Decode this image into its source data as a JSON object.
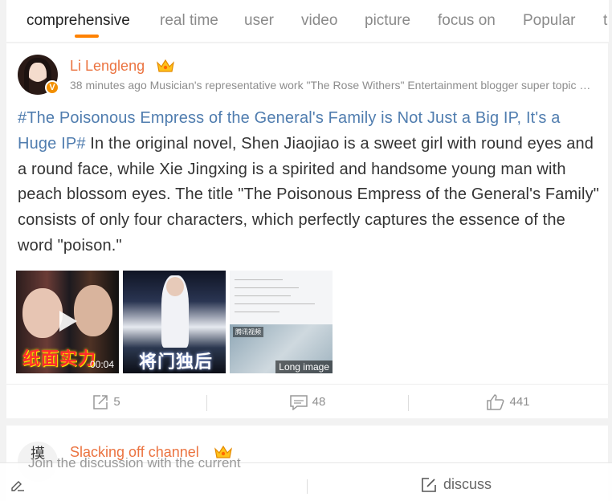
{
  "tabs": [
    "comprehensive",
    "real time",
    "user",
    "video",
    "picture",
    "focus on",
    "Popular",
    "t"
  ],
  "active_tab": "comprehensive",
  "colors": {
    "accent": "#ff8200",
    "username": "#eb7340",
    "hashtag": "#507daf",
    "verified": "#f28f00"
  },
  "post": {
    "username": "Li Lengleng",
    "meta": "38 minutes ago Musician's representative work \"The Rose Withers\" Entertainment blogger super topic post",
    "hashtag": "#The Poisonous Empress of the General's Family is Not Just a Big IP, It's a Huge IP#",
    "body": " In the original novel, Shen Jiaojiao is a sweet girl with round eyes and a round face, while Xie Jingxing is a spirited and handsome young man with peach blossom eyes. The title \"The Poisonous Empress of the General's Family\" consists of only four characters, which perfectly captures the essence of the word \"poison.\"",
    "verified_mark": "V",
    "images": [
      {
        "caption_text": "纸面实力",
        "duration": "00:04",
        "icon": "play-icon"
      },
      {
        "caption_text": "将门独后"
      },
      {
        "badge": "腾讯视频",
        "label": "Long image"
      }
    ],
    "actions": {
      "repost": "5",
      "comments": "48",
      "likes": "441"
    }
  },
  "post2": {
    "username": "Slacking off channel",
    "avatar_text": "摸"
  },
  "bottom": {
    "hint": "Join the discussion with the current",
    "discuss": "discuss"
  }
}
